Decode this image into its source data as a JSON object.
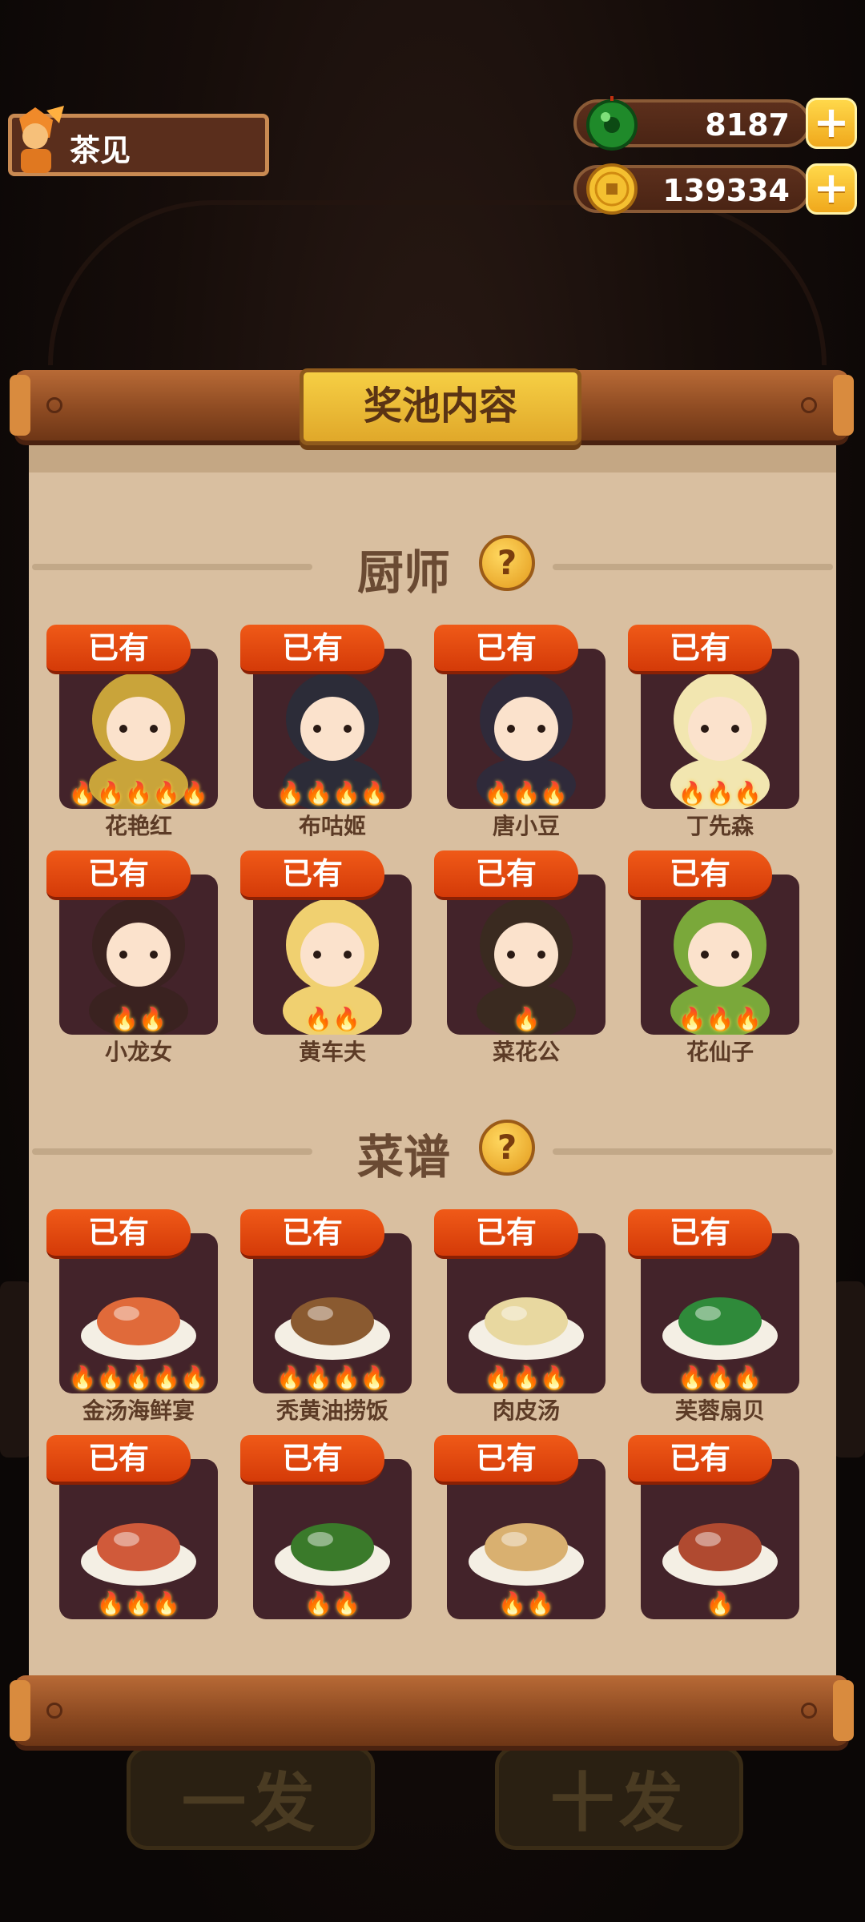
{
  "player": {
    "name": "茶见"
  },
  "currency": {
    "jade": "8187",
    "coins": "139334",
    "plus": "+"
  },
  "panel": {
    "title": "奖池内容"
  },
  "sections": {
    "chef_title": "厨师",
    "recipe_title": "菜谱",
    "help": "?"
  },
  "owned_label": "已有",
  "chefs": [
    {
      "name": "花艳红",
      "stars": 5
    },
    {
      "name": "布咕姬",
      "stars": 4
    },
    {
      "name": "唐小豆",
      "stars": 3
    },
    {
      "name": "丁先森",
      "stars": 3
    },
    {
      "name": "小龙女",
      "stars": 2
    },
    {
      "name": "黄车夫",
      "stars": 2
    },
    {
      "name": "菜花公",
      "stars": 1
    },
    {
      "name": "花仙子",
      "stars": 3
    }
  ],
  "recipes": [
    {
      "name": "金汤海鲜宴",
      "stars": 5
    },
    {
      "name": "秃黄油捞饭",
      "stars": 4
    },
    {
      "name": "肉皮汤",
      "stars": 3
    },
    {
      "name": "芙蓉扇贝",
      "stars": 3
    },
    {
      "name": "",
      "stars": 3
    },
    {
      "name": "",
      "stars": 2
    },
    {
      "name": "",
      "stars": 2
    },
    {
      "name": "",
      "stars": 1
    }
  ],
  "background": {
    "btn_one": "一发",
    "btn_ten": "十发"
  },
  "colors": {
    "badge": "#e04a10",
    "card": "#43232a",
    "paper": "#d9bfa0",
    "gold": "#f0b52c"
  }
}
